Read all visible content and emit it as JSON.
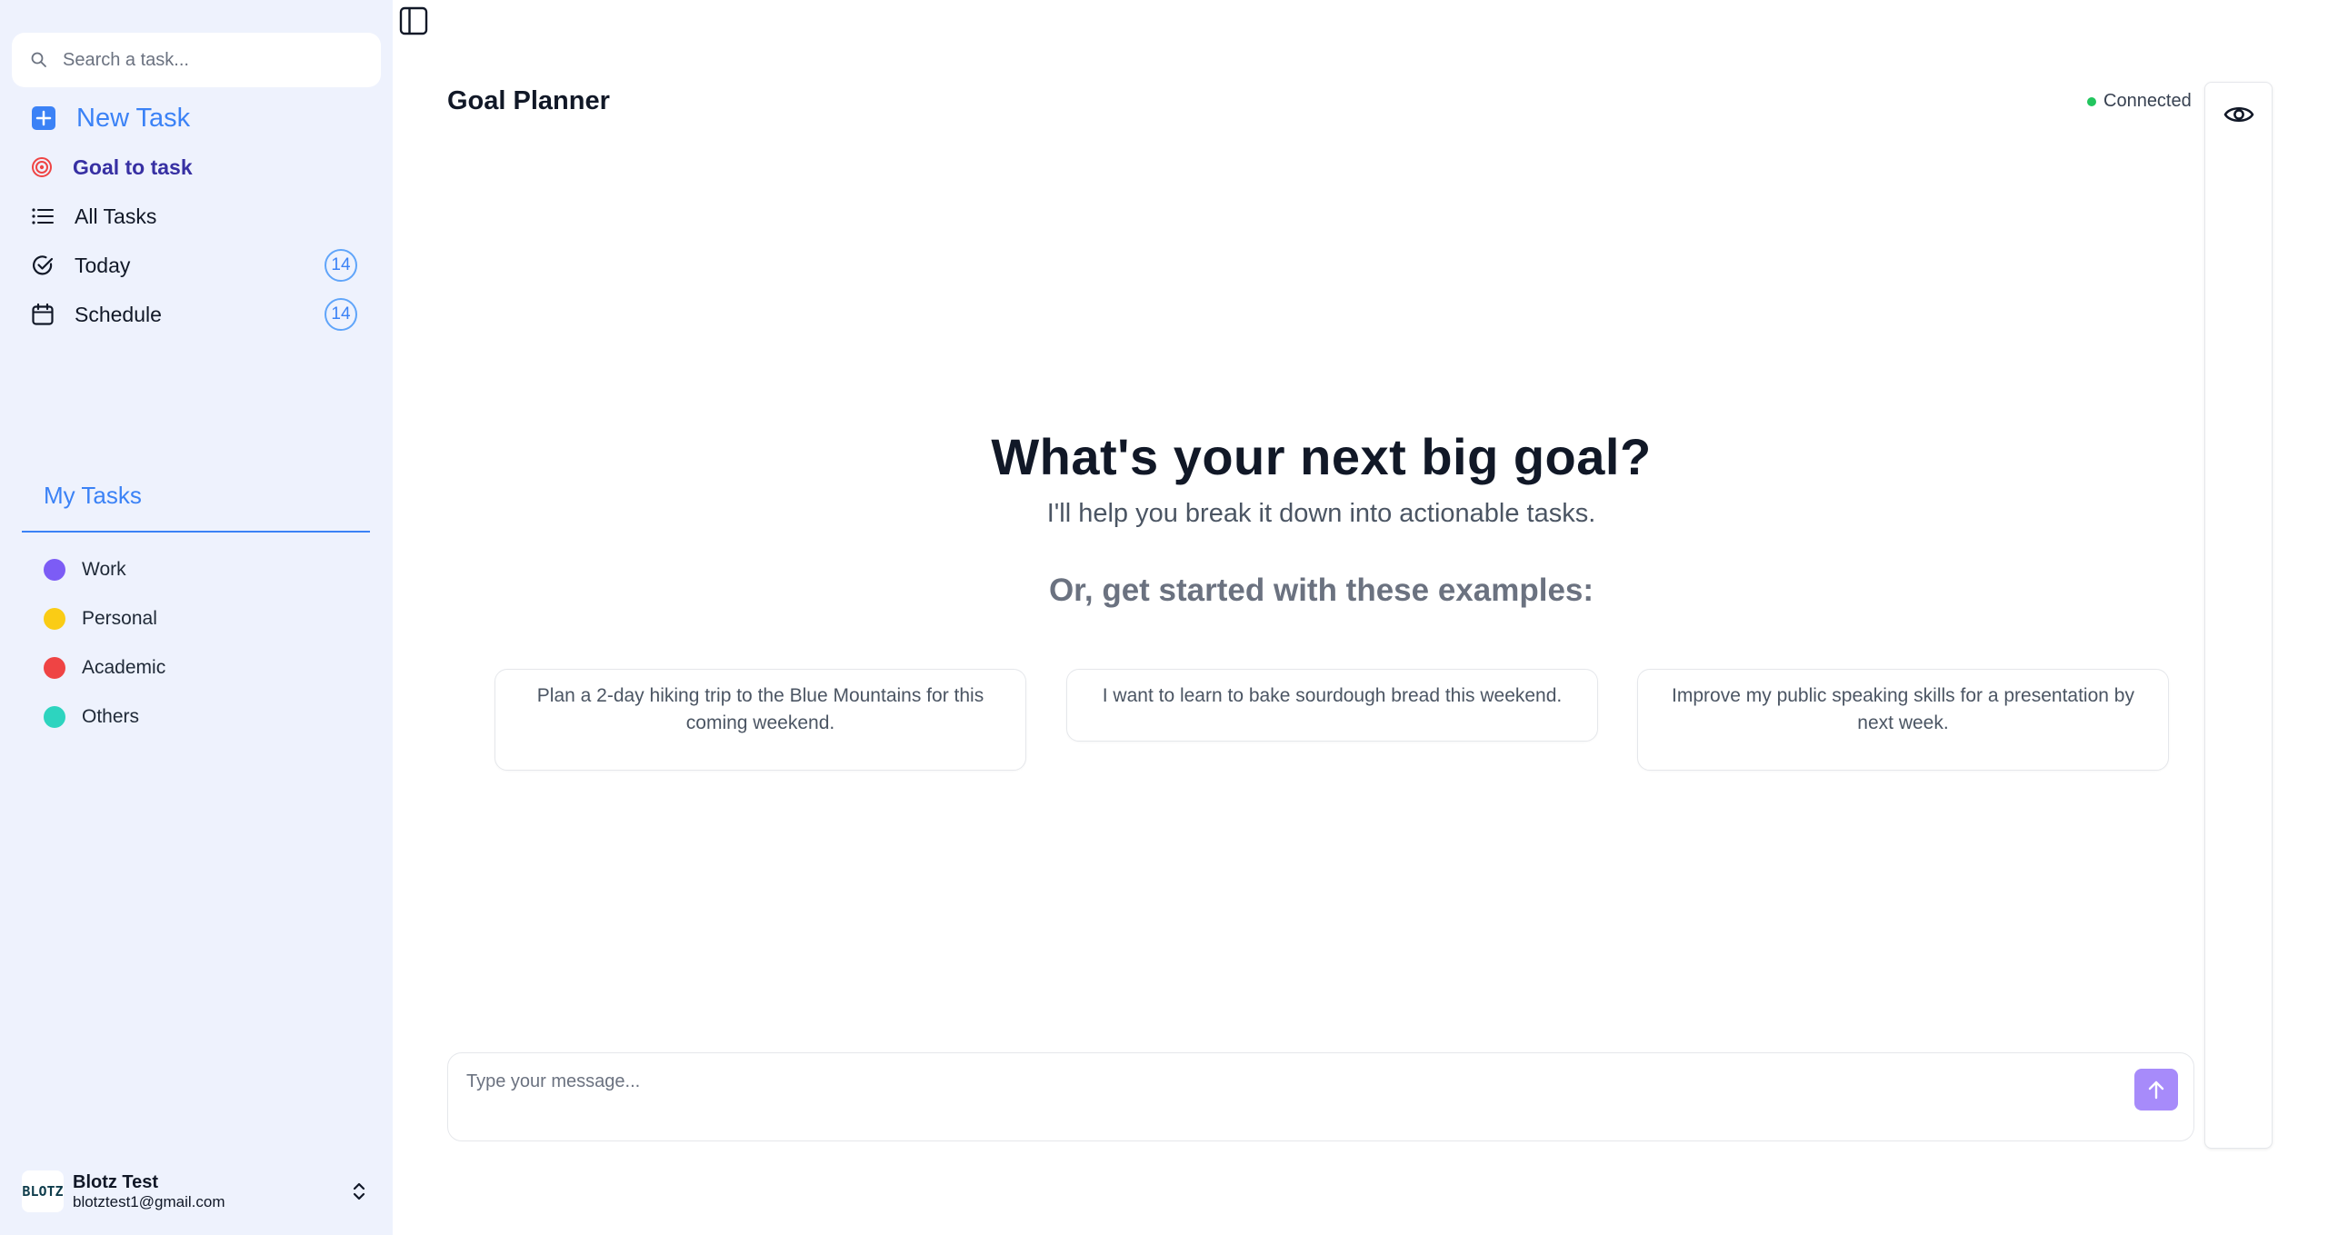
{
  "sidebar": {
    "search": {
      "placeholder": "Search a task..."
    },
    "nav": {
      "new_task": "New Task",
      "goal_to_task": "Goal to task",
      "all_tasks": "All Tasks",
      "today": {
        "label": "Today",
        "count": "14"
      },
      "schedule": {
        "label": "Schedule",
        "count": "14"
      }
    },
    "my_tasks": {
      "title": "My Tasks",
      "categories": [
        {
          "label": "Work",
          "color": "#7c5cf5"
        },
        {
          "label": "Personal",
          "color": "#facc15"
        },
        {
          "label": "Academic",
          "color": "#ef4444"
        },
        {
          "label": "Others",
          "color": "#2dd4bf"
        }
      ]
    },
    "user": {
      "logo_text": "BLOTZ",
      "name": "Blotz Test",
      "email": "blotztest1@gmail.com"
    }
  },
  "header": {
    "title": "Goal Planner",
    "status": "Connected",
    "status_color": "#22c55e"
  },
  "main": {
    "heading": "What's your next big goal?",
    "subheading": "I'll help you break it down into actionable tasks.",
    "examples_title": "Or, get started with these examples:",
    "examples": [
      "Plan a 2-day hiking trip to the Blue Mountains for this coming weekend.",
      "I want to learn to bake sourdough bread this weekend.",
      "Improve my public speaking skills for a presentation by next week."
    ]
  },
  "composer": {
    "placeholder": "Type your message..."
  },
  "icons": {
    "search": "search-icon",
    "new_task": "plus-square-icon",
    "goal": "target-icon",
    "all_tasks": "list-icon",
    "today": "check-circle-icon",
    "schedule": "calendar-icon",
    "toggle": "sidebar-toggle-icon",
    "eye": "eye-icon",
    "send": "arrow-up-icon",
    "chevron": "chevron-up-down-icon"
  },
  "colors": {
    "accent": "#3b82f6",
    "sidebar_bg": "#eef2fd",
    "send_button": "#a78bfa"
  }
}
